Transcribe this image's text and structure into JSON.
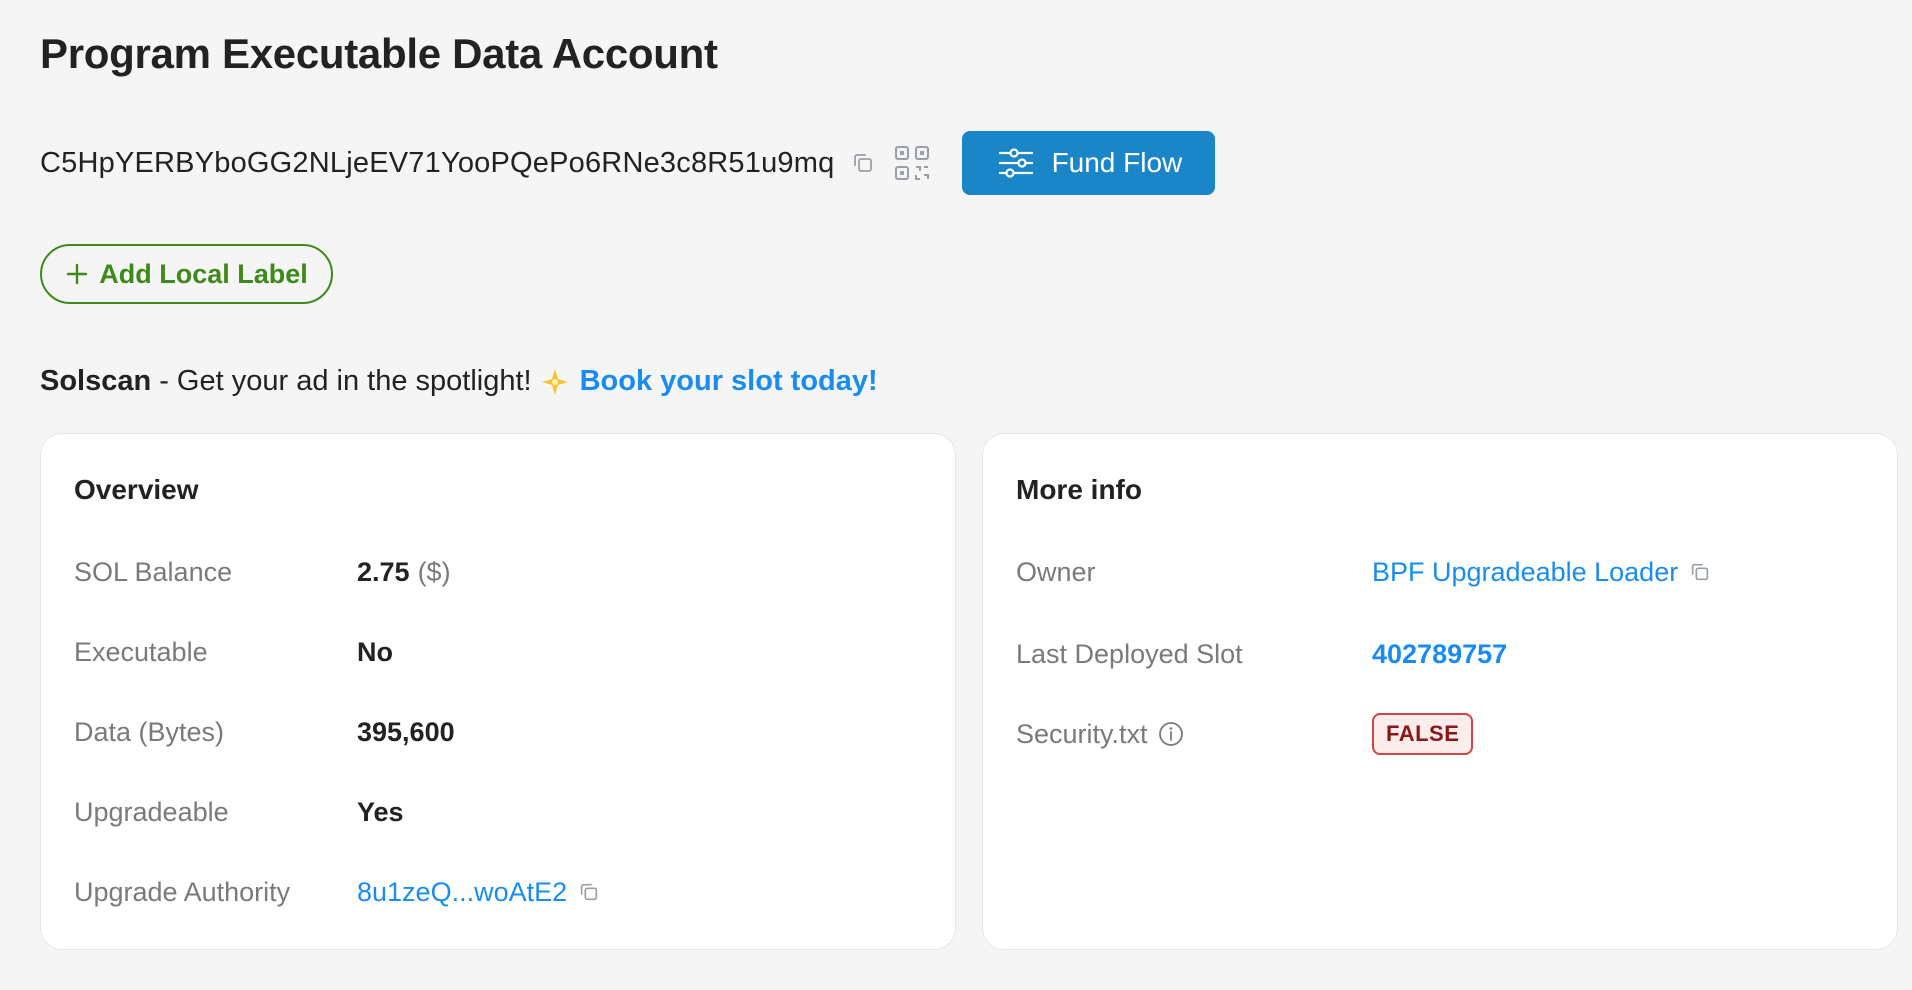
{
  "page": {
    "title": "Program Executable Data Account"
  },
  "address": {
    "value": "C5HpYERBYboGG2NLjeEV71YooPQePo6RNe3c8R51u9mq",
    "copy_icon": "copy-icon",
    "qr_icon": "qr-code-icon"
  },
  "fund_flow": {
    "label": "Fund Flow",
    "icon": "fund-flow-icon",
    "color": "#1a86c8"
  },
  "local_label": {
    "label": "Add Local Label",
    "icon": "plus-icon",
    "color": "#3d8a1a"
  },
  "ad": {
    "brand": "Solscan",
    "text": "- Get your ad in the spotlight!",
    "icon": "sparkle-icon",
    "cta": "Book your slot today!",
    "cta_color": "#1a8cf0"
  },
  "overview": {
    "title": "Overview",
    "rows": [
      {
        "label": "SOL Balance",
        "value": "2.75",
        "suffix": "($)"
      },
      {
        "label": "Executable",
        "value": "No"
      },
      {
        "label": "Data (Bytes)",
        "value": "395,600"
      },
      {
        "label": "Upgradeable",
        "value": "Yes"
      },
      {
        "label": "Upgrade Authority",
        "value": "8u1zeQ...woAtE2"
      }
    ]
  },
  "more_info": {
    "title": "More info",
    "rows": [
      {
        "label": "Owner",
        "value": "BPF Upgradeable Loader"
      },
      {
        "label": "Last Deployed Slot",
        "value": "402789757"
      },
      {
        "label": "Security.txt",
        "value": "FALSE",
        "icon": "info-icon"
      }
    ]
  },
  "colors": {
    "link": "#1a8cf0",
    "badge_border": "#d04545",
    "badge_text": "#8a1616"
  }
}
